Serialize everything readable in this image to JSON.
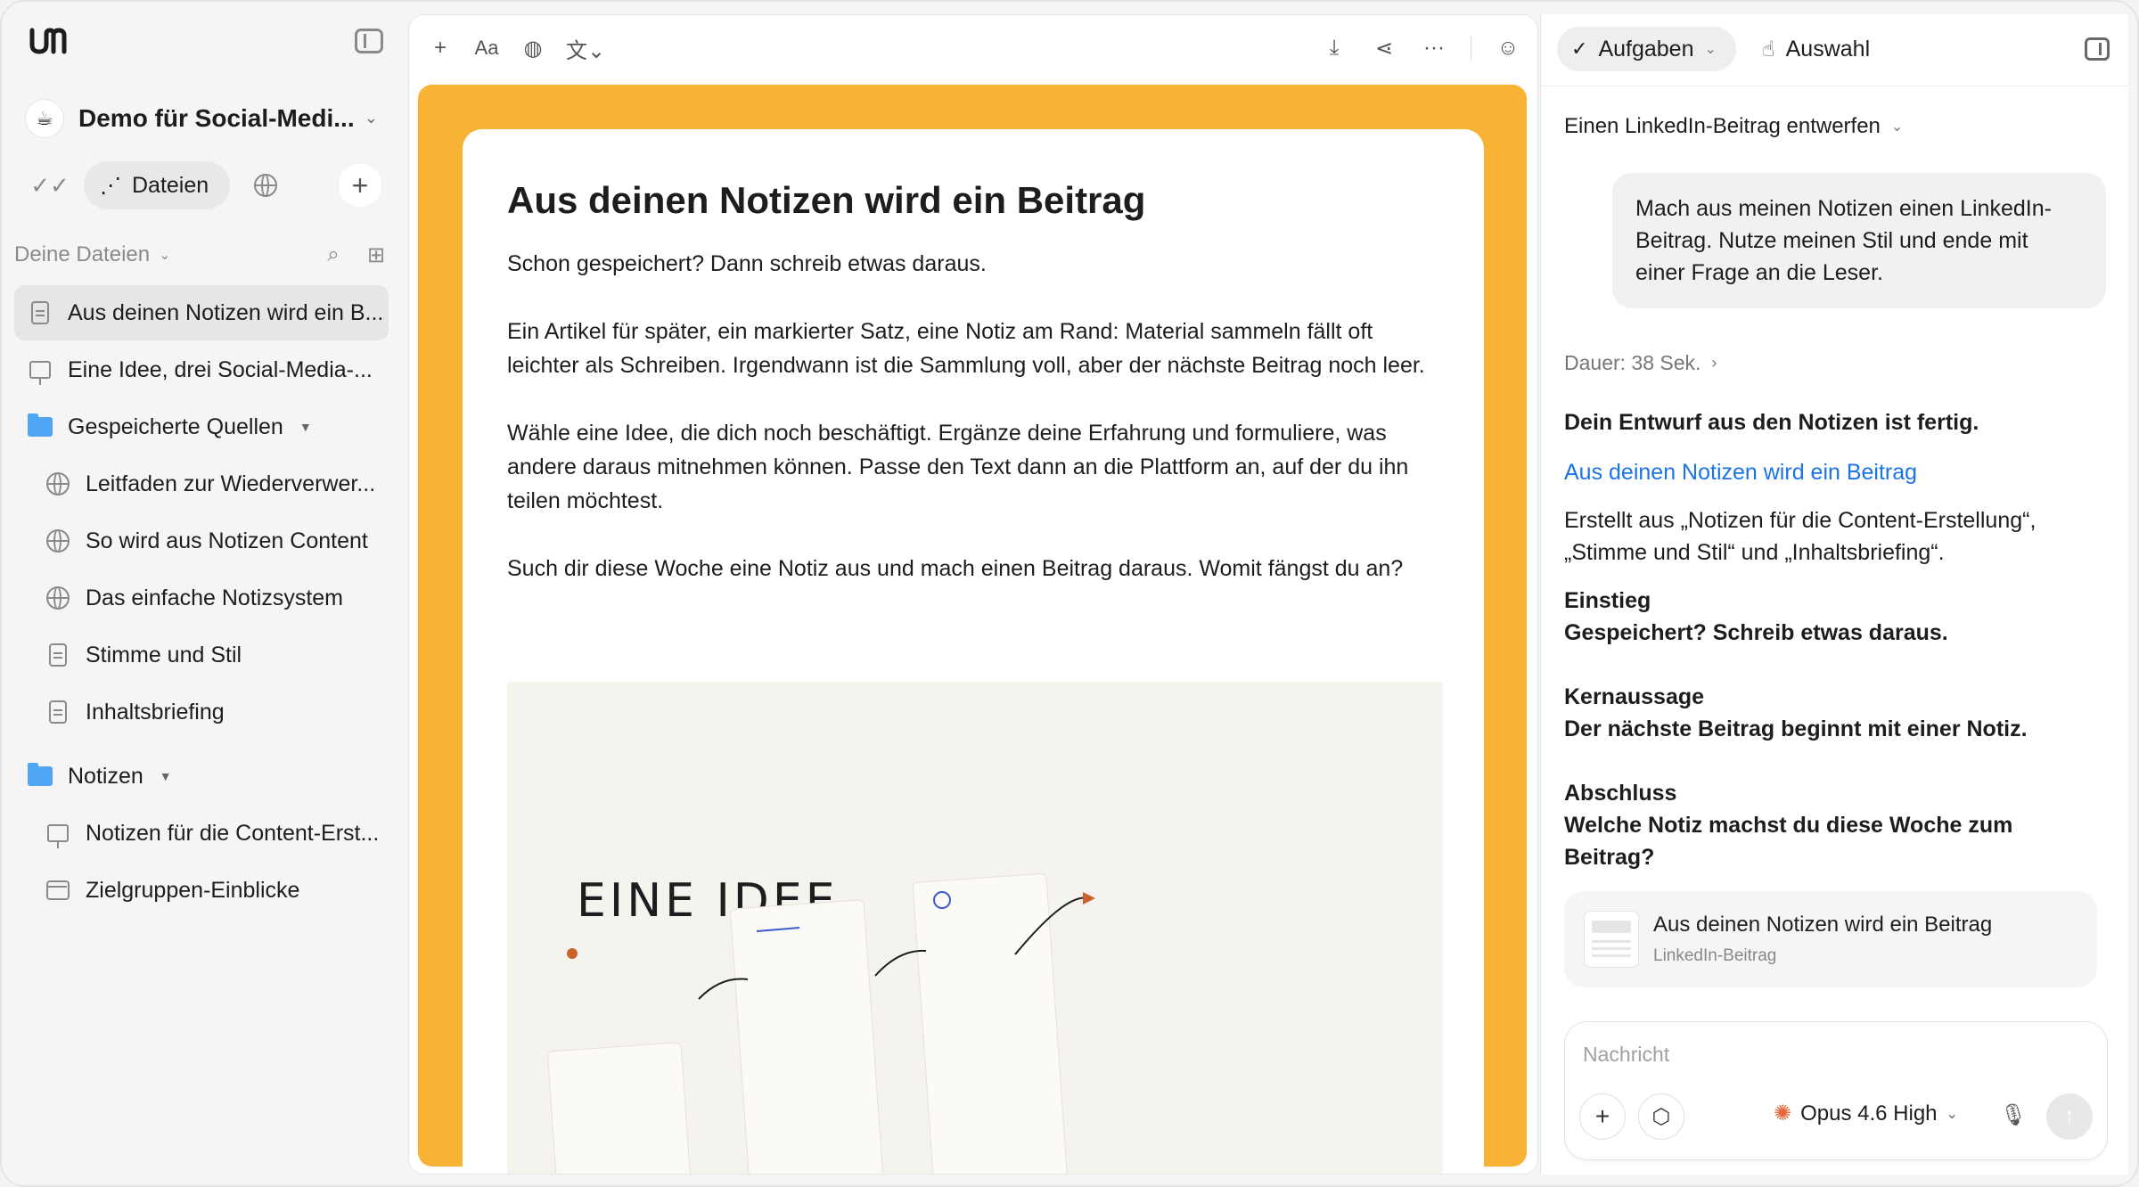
{
  "sidebar": {
    "workspace_name": "Demo für Social-Medi...",
    "modes": {
      "files_label": "Dateien"
    },
    "section_label": "Deine Dateien",
    "items": [
      {
        "label": "Aus deinen Notizen wird ein B...",
        "icon": "document-icon",
        "level": 1,
        "active": true
      },
      {
        "label": "Eine Idee, drei Social-Media-...",
        "icon": "presentation-icon",
        "level": 1
      },
      {
        "label": "Gespeicherte Quellen",
        "icon": "folder-icon",
        "level": 1,
        "folder": true
      },
      {
        "label": "Leitfaden zur Wiederverwer...",
        "icon": "globe-icon",
        "level": 2
      },
      {
        "label": "So wird aus Notizen Content",
        "icon": "globe-icon",
        "level": 2
      },
      {
        "label": "Das einfache Notizsystem",
        "icon": "globe-icon",
        "level": 2
      },
      {
        "label": "Stimme und Stil",
        "icon": "document-icon",
        "level": 2
      },
      {
        "label": "Inhaltsbriefing",
        "icon": "document-icon",
        "level": 2
      },
      {
        "label": "Notizen",
        "icon": "folder-icon",
        "level": 1,
        "folder": true
      },
      {
        "label": "Notizen für die Content-Erst...",
        "icon": "presentation-icon",
        "level": 2
      },
      {
        "label": "Zielgruppen-Einblicke",
        "icon": "window-icon",
        "level": 2
      }
    ]
  },
  "toolbar": {
    "font_label": "Aa"
  },
  "document": {
    "title": "Aus deinen Notizen wird ein Beitrag",
    "paragraphs": [
      "Schon gespeichert? Dann schreib etwas daraus.",
      "Ein Artikel für später, ein markierter Satz, eine Notiz am Rand: Material sammeln fällt oft leichter als Schreiben. Irgendwann ist die Sammlung voll, aber der nächste Beitrag noch leer.",
      "Wähle eine Idee, die dich noch beschäftigt. Ergänze deine Erfahrung und formuliere, was andere daraus mitnehmen können. Passe den Text dann an die Plattform an, auf der du ihn teilen möchtest.",
      "Such dir diese Woche eine Notiz aus und mach einen Beitrag daraus. Womit fängst du an?"
    ],
    "illustration_text": "EINE IDEE."
  },
  "panel": {
    "tab_tasks": "Aufgaben",
    "tab_selection": "Auswahl",
    "chat_title": "Einen LinkedIn-Beitrag entwerfen",
    "user_message": "Mach aus meinen Notizen einen LinkedIn-Beitrag. Nutze meinen Stil und ende mit einer Frage an die Leser.",
    "duration": "Dauer: 38 Sek.",
    "response": {
      "intro": "Dein Entwurf aus den Notizen ist fertig.",
      "link": "Aus deinen Notizen wird ein Beitrag",
      "created_from": "Erstellt aus „Notizen für die Content-Erstellung“, „Stimme und Stil“ und „Inhaltsbriefing“.",
      "hook_label": "Einstieg",
      "hook": "Gespeichert? Schreib etwas daraus.",
      "core_label": "Kernaussage",
      "core": "Der nächste Beitrag beginnt mit einer Notiz.",
      "close_label": "Abschluss",
      "close": "Welche Notiz machst du diese Woche zum Beitrag?"
    },
    "attachment": {
      "title": "Aus deinen Notizen wird ein Beitrag",
      "subtitle": "LinkedIn-Beitrag"
    },
    "composer": {
      "placeholder": "Nachricht",
      "model": "Opus 4.6 High"
    }
  },
  "colors": {
    "accent_orange": "#f8b334",
    "link_blue": "#1a73e8",
    "folder_blue": "#4ea6f5"
  }
}
